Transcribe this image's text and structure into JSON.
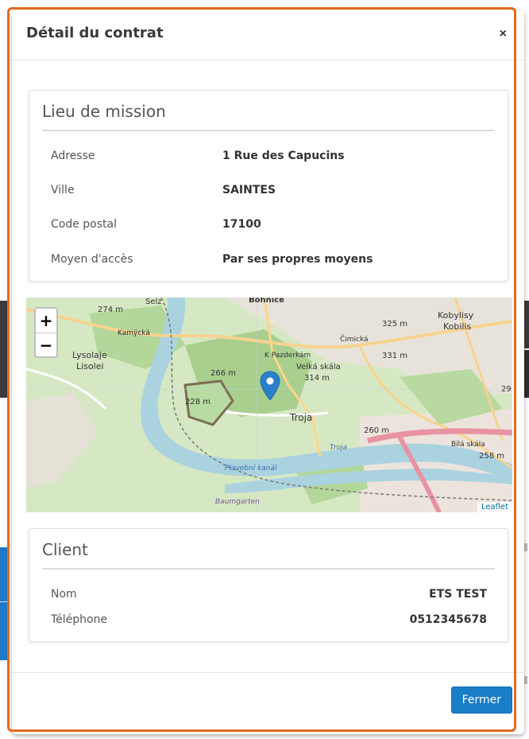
{
  "modal": {
    "title": "Détail du contrat",
    "close_symbol": "×"
  },
  "mission": {
    "title": "Lieu de mission",
    "rows": [
      {
        "label": "Adresse",
        "value": "1 Rue des Capucins"
      },
      {
        "label": "Ville",
        "value": "SAINTES"
      },
      {
        "label": "Code postal",
        "value": "17100"
      },
      {
        "label": "Moyen d'accès",
        "value": "Par ses propres moyens"
      }
    ]
  },
  "map": {
    "zoom_in": "+",
    "zoom_out": "−",
    "attribution": "Leaflet",
    "labels": {
      "bohnice": "Bohnice",
      "kobylisy": "Kobylisy",
      "kobylisy2": "Kobilis",
      "lysolaje": "Lysolaje",
      "lisolei": "Lisolei",
      "troja": "Troja",
      "velka_skala": "Velká skála",
      "e314": "314 m",
      "e325": "325 m",
      "e331": "331 m",
      "e274": "274 m",
      "e266": "266 m",
      "e228": "228 m",
      "e260": "260 m",
      "e258": "258 m",
      "kamycka": "Kamýcká",
      "k_pazderkam": "K Pazderkám",
      "cimicka": "Čimická",
      "troja_river": "Troja",
      "plavebni": "Plavební kanál",
      "baumgarten": "Baumgarten",
      "seiz": "Selz",
      "e29": "29",
      "bila_skala": "Bílá skála"
    }
  },
  "client": {
    "title": "Client",
    "rows": [
      {
        "label": "Nom",
        "value": "ETS TEST"
      },
      {
        "label": "Téléphone",
        "value": "0512345678"
      }
    ]
  },
  "footer": {
    "close_label": "Fermer"
  },
  "colors": {
    "accent": "#1a7dc8",
    "highlight_border": "#e36a1e"
  }
}
